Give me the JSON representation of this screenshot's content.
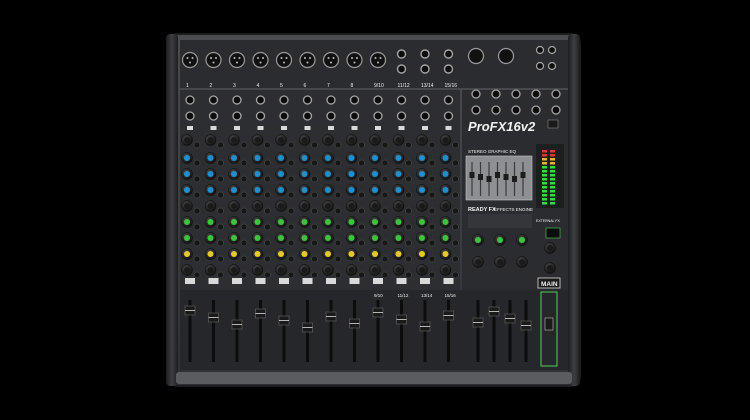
{
  "photo": {
    "brand_logo": "ProFX16v2",
    "sections": {
      "eq_title": "STEREO GRAPHIC EQ",
      "fx_title": "EFFECTS ENGINE",
      "fx_badge": "READY FX",
      "main_label": "MAIN",
      "ext_label": "EXTERNAL FX"
    },
    "channel_numbers": [
      "1",
      "2",
      "3",
      "4",
      "5",
      "6",
      "7",
      "8",
      "9/10",
      "11/12",
      "13/14",
      "15/16"
    ],
    "fader_channel_labels": [
      "9/10",
      "11/12",
      "13/14",
      "15/16"
    ],
    "colors": {
      "background": "#000000",
      "chassis": "#3a3c3f",
      "panel": "#2b2d30",
      "knob_blue": "#1f8fd0",
      "knob_green": "#3cc43c",
      "knob_yellow": "#e5c92a",
      "knob_black": "#1a1a1a",
      "led_green": "#39ff4a"
    },
    "icons": [
      "xlr-jack-icon",
      "quarter-inch-jack-icon",
      "knob-icon",
      "fader-icon",
      "led-meter-icon",
      "usb-icon"
    ]
  }
}
